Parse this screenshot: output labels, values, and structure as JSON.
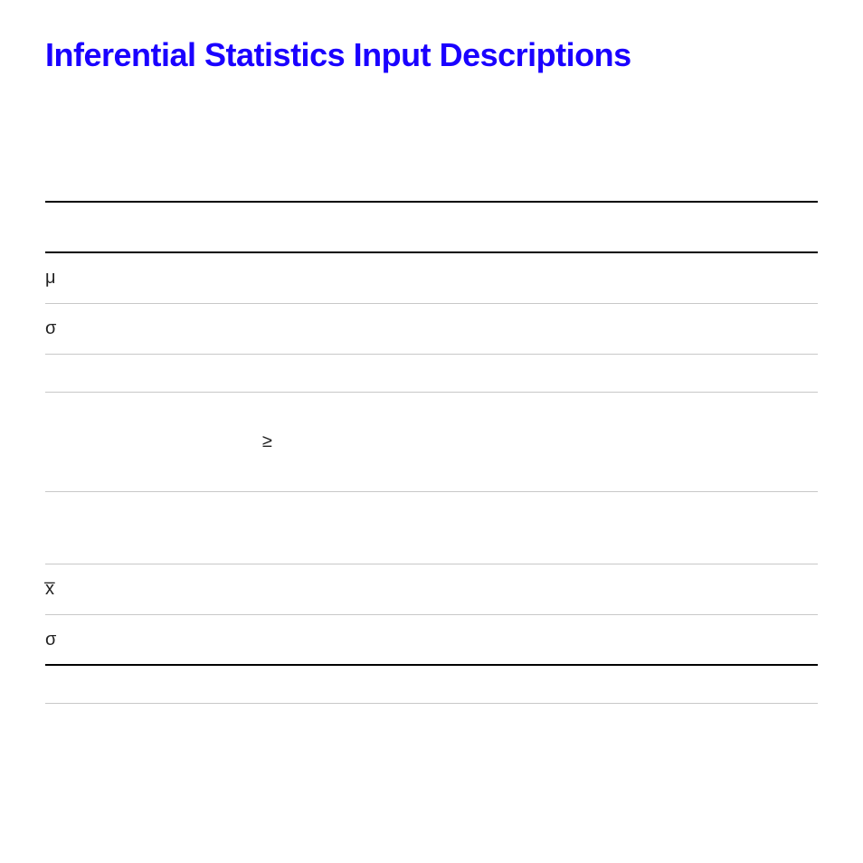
{
  "title": "Inferential Statistics Input Descriptions",
  "section1": {
    "rows": [
      {
        "symbol": "μ"
      },
      {
        "symbol": "σ"
      },
      {
        "symbol": ""
      }
    ],
    "gteRow": {
      "symbol": "≥"
    }
  },
  "section2": {
    "rows": [
      {
        "symbol": "x̅"
      },
      {
        "symbol": "σ"
      }
    ]
  }
}
